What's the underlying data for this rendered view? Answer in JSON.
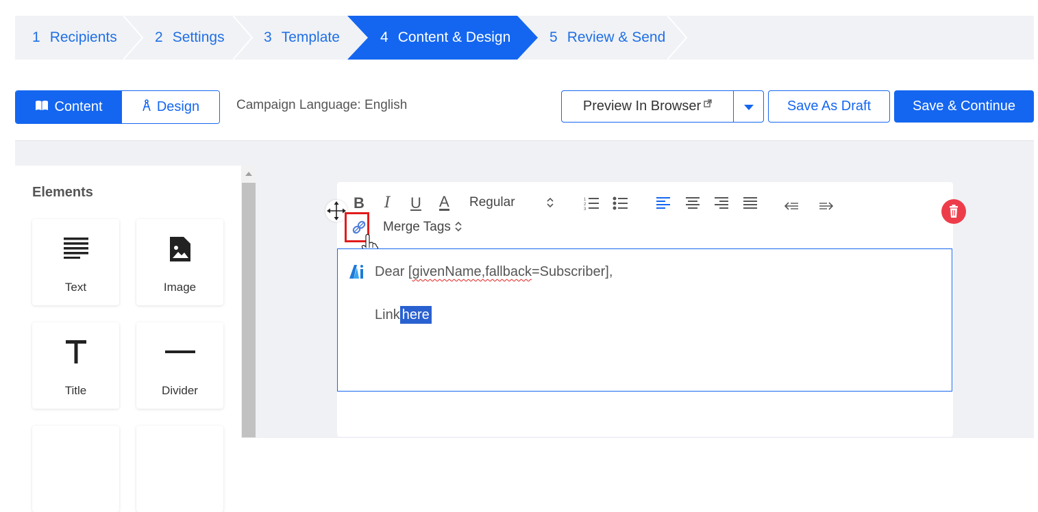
{
  "stepper": {
    "steps": [
      {
        "num": "1",
        "label": "Recipients"
      },
      {
        "num": "2",
        "label": "Settings"
      },
      {
        "num": "3",
        "label": "Template"
      },
      {
        "num": "4",
        "label": "Content & Design"
      },
      {
        "num": "5",
        "label": "Review & Send"
      }
    ],
    "active_index": 3
  },
  "mode_toggle": {
    "content_label": "Content",
    "design_label": "Design",
    "selected": "Content"
  },
  "campaign_language": "Campaign Language: English",
  "actions": {
    "preview_label": "Preview In Browser",
    "save_draft_label": "Save As Draft",
    "save_continue_label": "Save & Continue"
  },
  "elements_panel": {
    "title": "Elements",
    "items": [
      {
        "label": "Text",
        "icon": "text-lines-icon"
      },
      {
        "label": "Image",
        "icon": "image-file-icon"
      },
      {
        "label": "Title",
        "icon": "title-t-icon"
      },
      {
        "label": "Divider",
        "icon": "divider-line-icon"
      }
    ]
  },
  "editor_toolbar": {
    "bold": "B",
    "italic": "I",
    "underline": "U",
    "font_color": "A",
    "font_weight": "Regular",
    "merge_tags_label": "Merge Tags"
  },
  "editor_content": {
    "line1_before": "Dear [",
    "line1_misspelled": "givenName,fallback",
    "line1_after": "=Subscriber],",
    "line2_prefix": "Link",
    "line2_selected": "here"
  },
  "colors": {
    "accent": "#1466f0",
    "delete": "#ee3d4a",
    "highlight": "#e01b1b",
    "selection": "#2a61d0"
  }
}
